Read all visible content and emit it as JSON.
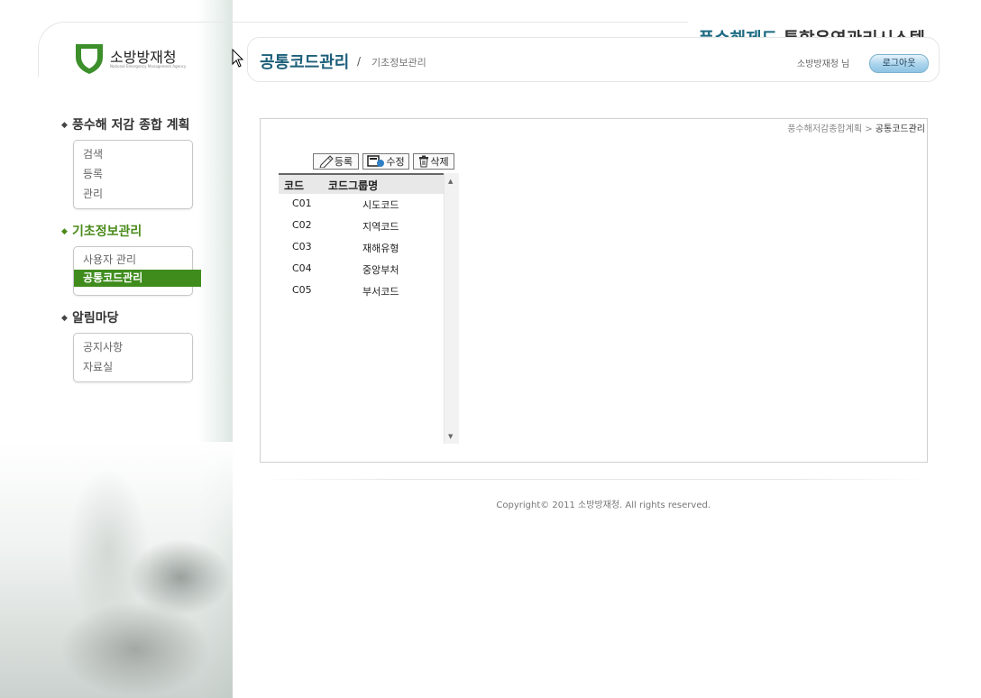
{
  "logo": {
    "name": "소방방재청",
    "sub": "National Emergency Management Agency"
  },
  "header": {
    "system_title_accent": "풍수해제도",
    "system_title_rest": " 통합운영관리시스템",
    "page_title": "공통코드관리",
    "separator": "/",
    "page_parent": "기초정보관리",
    "user_name": "소방방재청 님",
    "logout_label": "로그아웃"
  },
  "sidebar": {
    "groups": [
      {
        "title": "풍수해 저감 종합 계획",
        "items": [
          "검색",
          "등록",
          "관리"
        ]
      },
      {
        "title": "기초정보관리",
        "items": [
          "사용자 관리",
          "공통코드관리"
        ],
        "active": true,
        "selected_item": "공통코드관리"
      },
      {
        "title": "알림마당",
        "items": [
          "공지사항",
          "자료실"
        ]
      }
    ]
  },
  "breadcrumb": {
    "parent": "풍수해저감종합계획",
    "arrow": ">",
    "current": "공통코드관리"
  },
  "toolbar": {
    "register_label": "등록",
    "edit_label": "수정",
    "delete_label": "삭제"
  },
  "grid": {
    "columns": [
      "코드",
      "코드그룹명"
    ],
    "rows": [
      [
        "C01",
        "시도코드"
      ],
      [
        "C02",
        "지역코드"
      ],
      [
        "C03",
        "재해유형"
      ],
      [
        "C04",
        "중앙부처"
      ],
      [
        "C05",
        "부서코드"
      ]
    ]
  },
  "footer": {
    "copyright": "Copyright© 2011 소방방재청. All rights reserved."
  },
  "colors": {
    "accent_blue": "#1d6a82",
    "active_green": "#3f8c1d",
    "logo_green": "#3c8f2b"
  },
  "icons": [
    "shield-logo-icon",
    "pencil-icon",
    "edit-document-icon",
    "trash-icon",
    "scroll-up-icon",
    "scroll-down-icon",
    "mouse-cursor-icon"
  ]
}
